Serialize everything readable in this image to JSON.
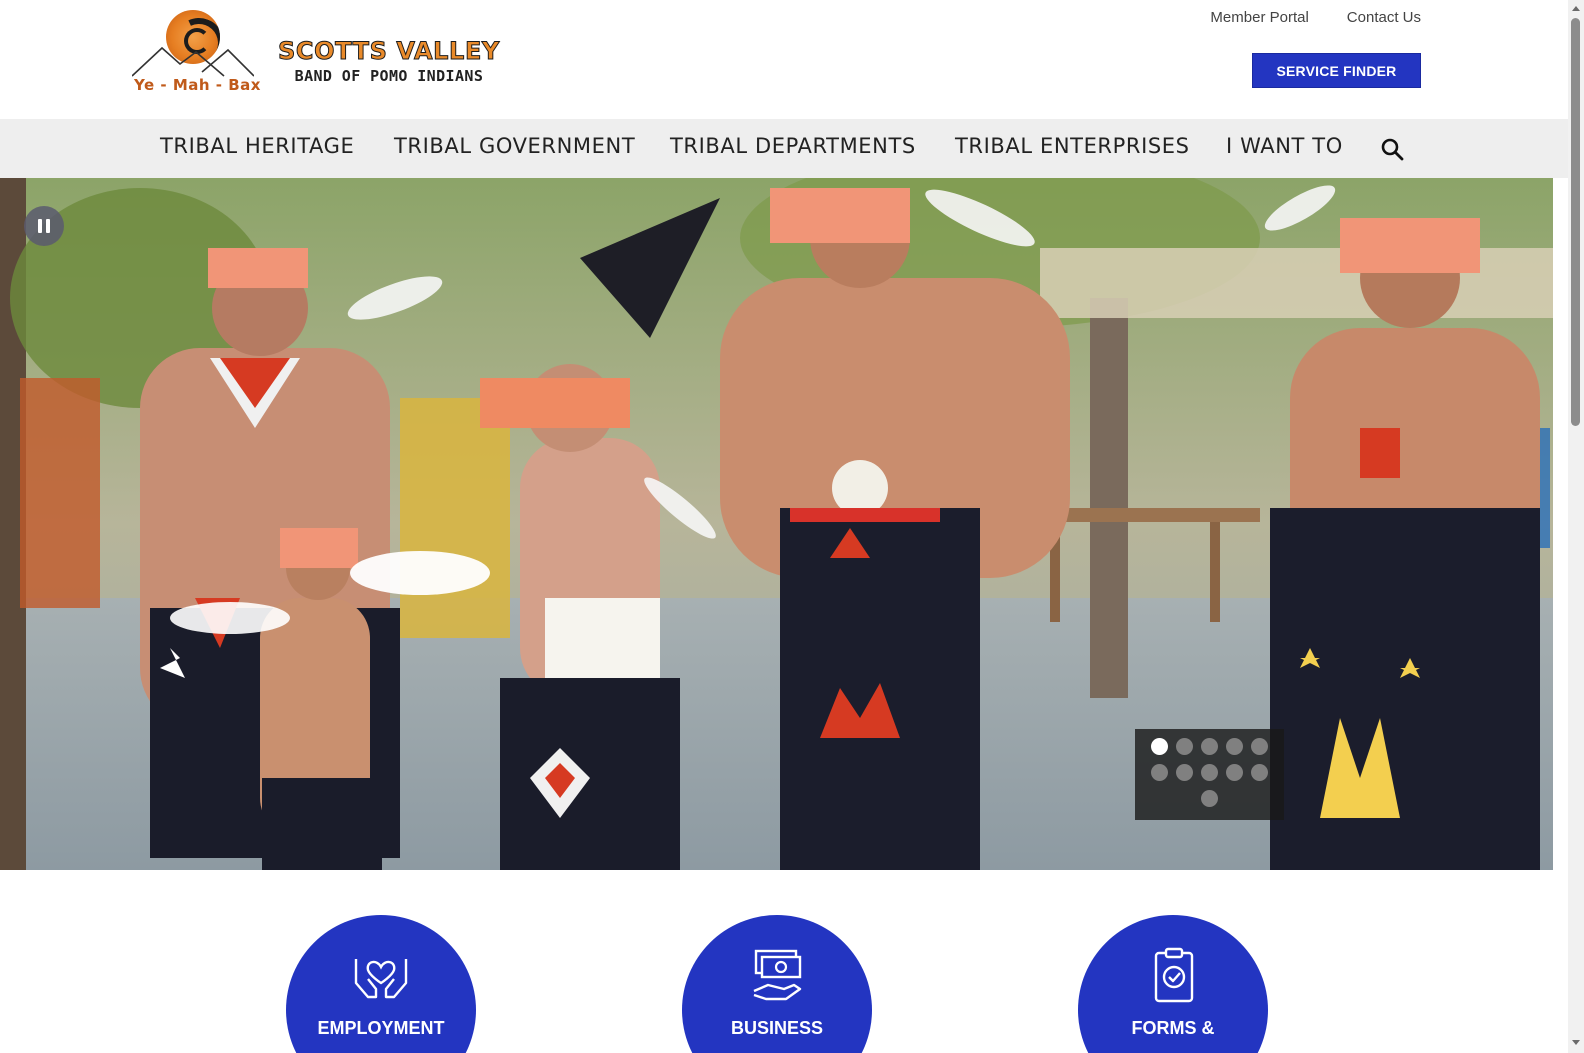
{
  "header": {
    "logo": {
      "tagline": "Ye - Mah - Bax",
      "title": "SCOTTS VALLEY",
      "subtitle": "BAND OF POMO INDIANS"
    },
    "utility_links": [
      "Member Portal",
      "Contact Us"
    ],
    "service_finder_label": "SERVICE FINDER"
  },
  "nav": {
    "items": [
      "TRIBAL HERITAGE",
      "TRIBAL GOVERNMENT",
      "TRIBAL DEPARTMENTS",
      "TRIBAL ENTERPRISES",
      "I WANT TO"
    ],
    "search_icon": "search-icon"
  },
  "hero": {
    "pause_icon": "pause-icon",
    "slide_count": 11,
    "active_slide": 1
  },
  "cards": [
    {
      "label": "EMPLOYMENT",
      "icon": "heart-hands-icon"
    },
    {
      "label": "BUSINESS",
      "icon": "money-hand-icon"
    },
    {
      "label": "FORMS &",
      "icon": "clipboard-check-icon"
    }
  ],
  "colors": {
    "brand_blue": "#2335c1",
    "nav_bg": "#eeeeee",
    "logo_orange": "#e98a2a"
  }
}
